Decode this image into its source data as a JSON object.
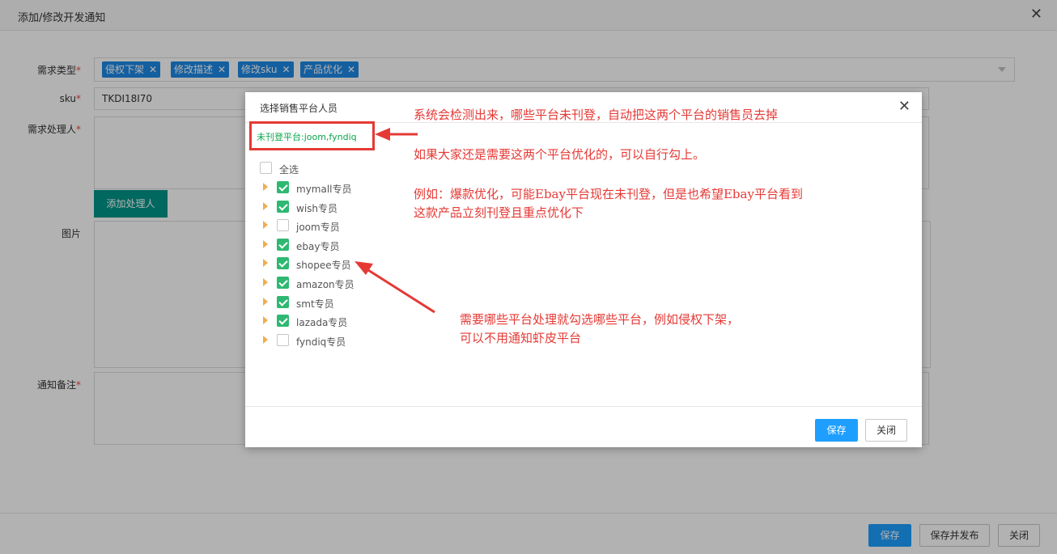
{
  "window": {
    "title": "添加/修改开发通知",
    "close": "✕"
  },
  "form": {
    "type_label": "需求类型",
    "type_tags": [
      "侵权下架",
      "修改描述",
      "修改sku",
      "产品优化"
    ],
    "tag_remove": "✕",
    "sku_label": "sku",
    "sku_value": "TKDI18I70",
    "handler_label": "需求处理人",
    "add_handler_button": "添加处理人",
    "image_label": "图片",
    "remark_label": "通知备注",
    "required_mark": "*"
  },
  "footer": {
    "save": "保存",
    "save_publish": "保存并发布",
    "close": "关闭"
  },
  "modal": {
    "title": "选择销售平台人员",
    "close": "✕",
    "unlisted_notice": "未刊登平台:joom,fyndiq",
    "select_all": "全选",
    "items": [
      {
        "label": "mymall专员",
        "checked": true
      },
      {
        "label": "wish专员",
        "checked": true
      },
      {
        "label": "joom专员",
        "checked": false
      },
      {
        "label": "ebay专员",
        "checked": true
      },
      {
        "label": "shopee专员",
        "checked": true
      },
      {
        "label": "amazon专员",
        "checked": true
      },
      {
        "label": "smt专员",
        "checked": true
      },
      {
        "label": "lazada专员",
        "checked": true
      },
      {
        "label": "fyndiq专员",
        "checked": false
      }
    ],
    "save": "保存",
    "close_button": "关闭"
  },
  "annotations": {
    "a1": "系统会检测出来，哪些平台未刊登，自动把这两个平台的销售员去掉",
    "a2": "如果大家还是需要这两个平台优化的，可以自行勾上。",
    "a3_line1": "例如：爆款优化，可能Ebay平台现在未刊登，但是也希望Ebay平台看到",
    "a3_line2": "这款产品立刻刊登且重点优化下",
    "a4_line1": "需要哪些平台处理就勾选哪些平台，例如侵权下架，",
    "a4_line2": "可以不用通知虾皮平台"
  },
  "colors": {
    "tag": "#1e88e5",
    "teal": "#009688",
    "primary": "#1e9fff",
    "checked": "#2eb872",
    "annotation": "#e53935",
    "notice": "#09a64a"
  }
}
